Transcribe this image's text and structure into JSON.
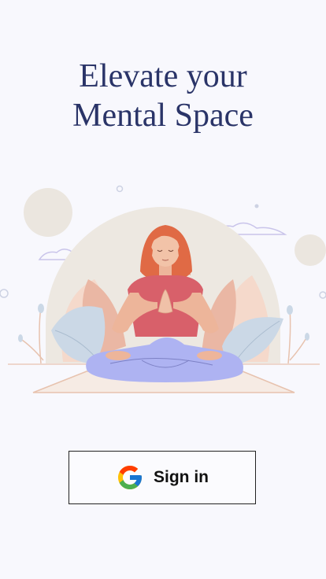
{
  "welcome": {
    "title_line1": "Elevate your",
    "title_line2": "Mental Space"
  },
  "illustration": {
    "subject": "woman-meditating-lotus-pose"
  },
  "signin": {
    "label": "Sign in",
    "icon": "google-icon"
  },
  "colors": {
    "background": "#f8f8fd",
    "title": "#2a3468",
    "button_border": "#222222",
    "google_blue": "#4285F4",
    "google_red": "#EA4335",
    "google_yellow": "#FBBC05",
    "google_green": "#34A853"
  }
}
